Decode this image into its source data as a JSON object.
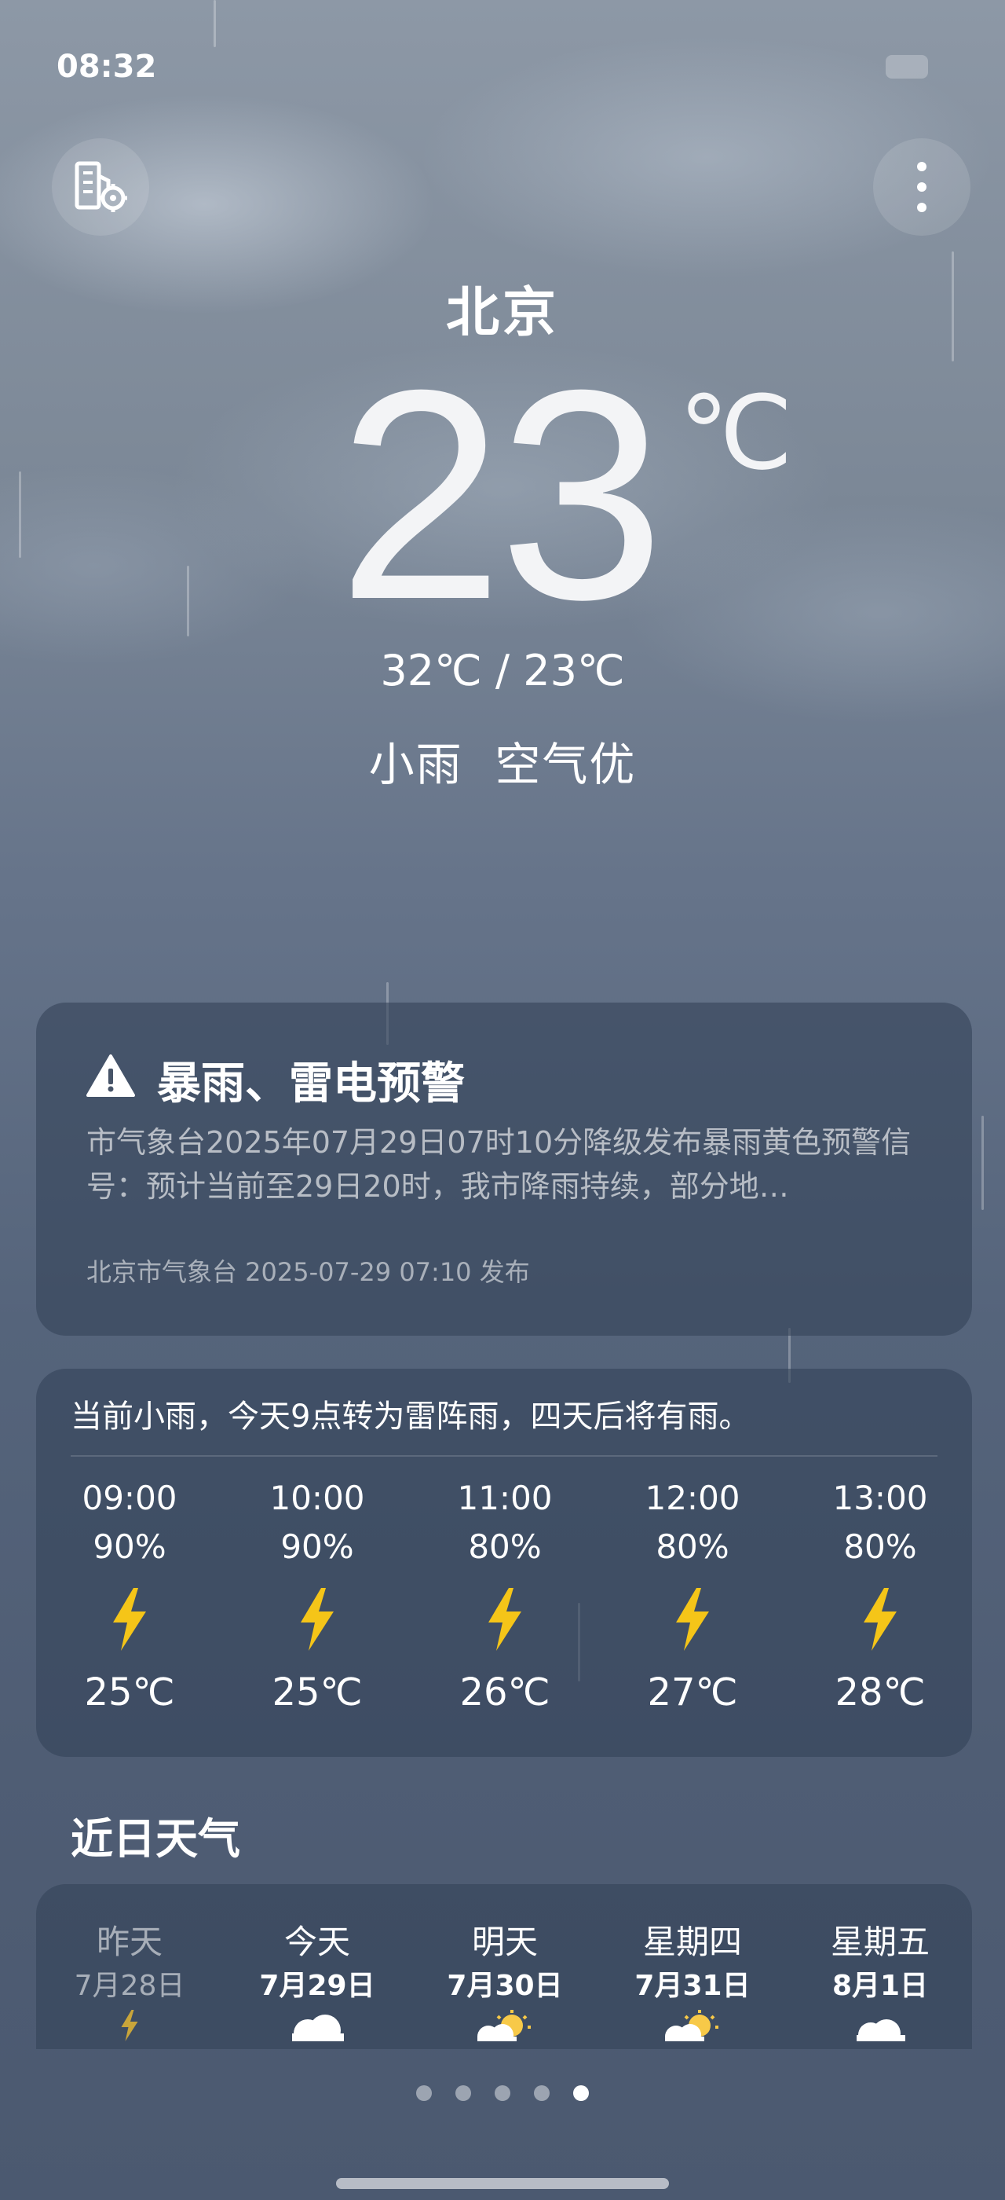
{
  "status_bar": {
    "time": "08:32"
  },
  "location": {
    "city": "北京"
  },
  "current": {
    "temperature": "23",
    "unit": "℃",
    "range": "32℃ / 23℃",
    "condition": "小雨  空气优"
  },
  "alert": {
    "title": "暴雨、雷电预警",
    "body": "市气象台2025年07月29日07时10分降级发布暴雨黄色预警信号：预计当前至29日20时，我市降雨持续，部分地…",
    "source": "北京市气象台 2025-07-29 07:10 发布",
    "icon": "warning-triangle-icon"
  },
  "hourly": {
    "summary": "当前小雨，今天9点转为雷阵雨，四天后将有雨。",
    "items": [
      {
        "time": "09:00",
        "precip": "90%",
        "icon": "lightning-icon",
        "temp": "25℃"
      },
      {
        "time": "10:00",
        "precip": "90%",
        "icon": "lightning-icon",
        "temp": "25℃"
      },
      {
        "time": "11:00",
        "precip": "80%",
        "icon": "lightning-icon",
        "temp": "26℃"
      },
      {
        "time": "12:00",
        "precip": "80%",
        "icon": "lightning-icon",
        "temp": "27℃"
      },
      {
        "time": "13:00",
        "precip": "80%",
        "icon": "lightning-icon",
        "temp": "28℃"
      }
    ]
  },
  "recent": {
    "title": "近日天气",
    "days": [
      {
        "name": "昨天",
        "date": "7月28日",
        "icon": "lightning-icon"
      },
      {
        "name": "今天",
        "date": "7月29日",
        "icon": "cloud-icon"
      },
      {
        "name": "明天",
        "date": "7月30日",
        "icon": "sun-cloud-icon"
      },
      {
        "name": "星期四",
        "date": "7月31日",
        "icon": "sun-cloud-icon"
      },
      {
        "name": "星期五",
        "date": "8月1日",
        "icon": "cloud-icon"
      }
    ]
  },
  "pager": {
    "count": 5,
    "active_index": 4
  },
  "colors": {
    "lightning": "#f5c518",
    "sun": "#f7c948",
    "card": "#344258"
  }
}
